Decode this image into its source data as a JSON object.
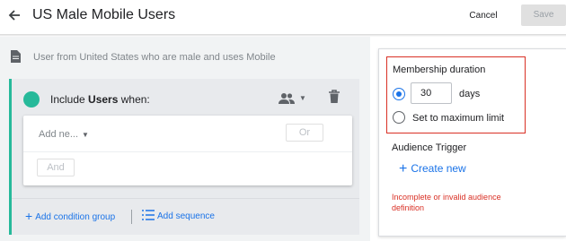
{
  "header": {
    "title": "US Male Mobile Users",
    "cancel_label": "Cancel",
    "save_label": "Save"
  },
  "description": "User from United States who are male and uses Mobile",
  "condition_group": {
    "include_prefix": "Include ",
    "scope": "Users",
    "include_suffix": " when:",
    "add_new_placeholder": "Add ne...",
    "or_label": "Or",
    "and_label": "And"
  },
  "footer_actions": {
    "add_condition_group": "Add condition group",
    "add_sequence": "Add sequence"
  },
  "membership": {
    "label": "Membership duration",
    "duration_value": "30",
    "unit": "days",
    "max_limit_label": "Set to maximum limit",
    "selected": "duration"
  },
  "audience_trigger": {
    "label": "Audience Trigger",
    "create_new_label": "Create new"
  },
  "error_message": "Incomplete or invalid audience definition",
  "colors": {
    "accent_blue": "#1a73e8",
    "teal": "#26b99a",
    "error_red": "#d93025"
  },
  "icons": [
    "back-arrow-icon",
    "document-icon",
    "people-icon",
    "chevron-down-icon",
    "trash-icon",
    "plus-icon",
    "sequence-icon"
  ]
}
